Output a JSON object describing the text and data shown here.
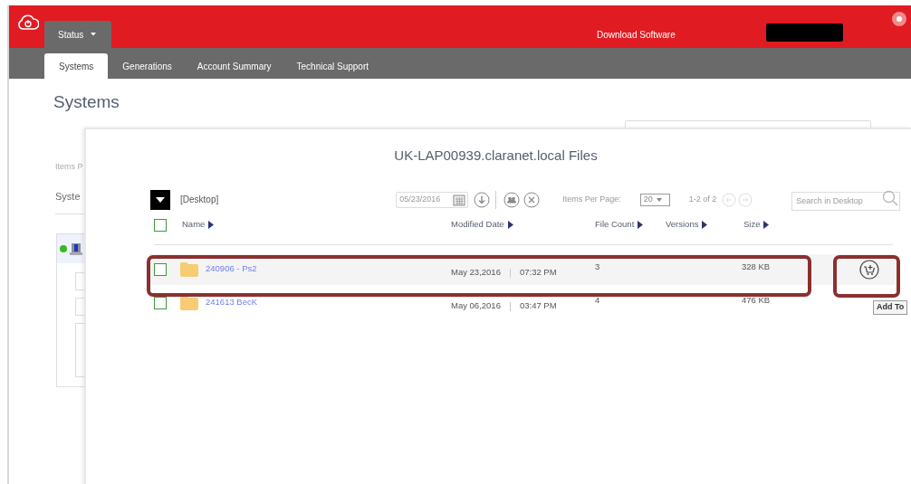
{
  "header": {
    "menu": {
      "label": "Status"
    },
    "download_link": "Download Software"
  },
  "nav_tabs": [
    {
      "label": "Systems",
      "selected": true
    },
    {
      "label": "Generations",
      "selected": false
    },
    {
      "label": "Account Summary",
      "selected": false
    },
    {
      "label": "Technical Support",
      "selected": false
    }
  ],
  "page": {
    "title": "Systems",
    "items_per_page_label": "Items P",
    "list_label": "Syste"
  },
  "modal": {
    "title": "UK-LAP00939.claranet.local Files",
    "folder": "[Desktop]",
    "date": "05/23/2016",
    "items_per_page_label": "Items Per Page:",
    "items_per_page": "20",
    "range": "1-2 of 2",
    "search": {
      "placeholder": "Search in Desktop"
    },
    "select_all": {
      "checked": false
    },
    "columns": [
      "Name",
      "Modified Date",
      "File Count",
      "Versions",
      "Size"
    ],
    "rows": [
      {
        "name": "240906 - Ps2",
        "date": "May 23,2016",
        "time": "07:32 PM",
        "file_count": "3",
        "size": "328 KB",
        "checked": false,
        "selected": true
      },
      {
        "name": "241613 BecK",
        "date": "May 06,2016",
        "time": "03:47 PM",
        "file_count": "4",
        "size": "476 KB",
        "checked": false,
        "selected": false
      }
    ],
    "tooltip": "Add To"
  }
}
